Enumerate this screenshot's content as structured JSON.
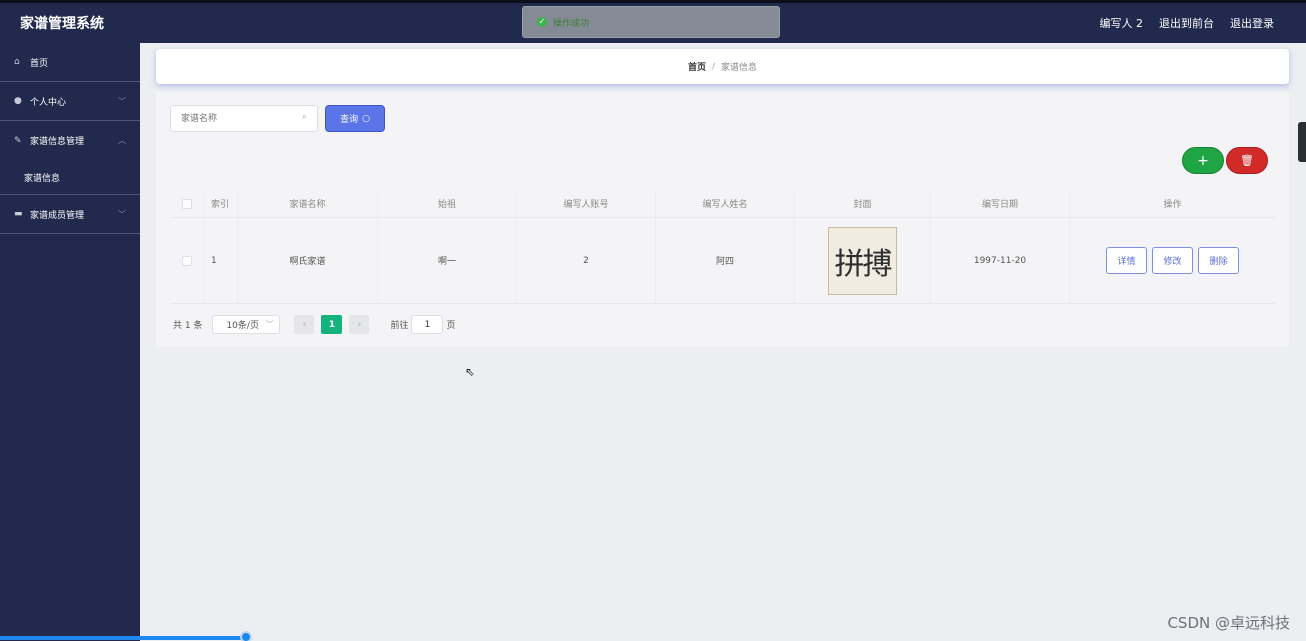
{
  "header": {
    "brand": "家谱管理系统",
    "user": "编写人 2",
    "exit_front": "退出到前台",
    "logout": "退出登录"
  },
  "toast": {
    "text": "操作成功",
    "icon": "check-circle-icon"
  },
  "sidebar": {
    "items": [
      {
        "label": "首页",
        "icon": "home-icon"
      },
      {
        "label": "个人中心",
        "icon": "user-icon"
      },
      {
        "label": "家谱信息管理",
        "icon": "book-icon"
      },
      {
        "label": "家谱信息",
        "sub": true
      },
      {
        "label": "家谱成员管理",
        "icon": "monitor-icon"
      }
    ]
  },
  "breadcrumb": {
    "home": "首页",
    "separator": "/",
    "current": "家谱信息"
  },
  "search": {
    "placeholder": "家谱名称",
    "button": "查询"
  },
  "table": {
    "headers": [
      "索引",
      "家谱名称",
      "始祖",
      "编写人账号",
      "编写人姓名",
      "封面",
      "编写日期",
      "操作"
    ],
    "rows": [
      {
        "index": "1",
        "name": "啊氏家谱",
        "ancestor": "啊一",
        "account": "2",
        "writer": "阿四",
        "cover_text": "拼搏",
        "date": "1997-11-20"
      }
    ],
    "actions": {
      "detail": "详情",
      "edit": "修改",
      "delete": "删除"
    }
  },
  "pagination": {
    "total": "共 1 条",
    "page_size": "10条/页",
    "current_page": "1",
    "goto_label": "前往",
    "goto_value": "1",
    "page_suffix": "页"
  },
  "watermark": "CSDN @卓远科技",
  "colors": {
    "header_bg": "#212a4d",
    "primary": "#5b75e8",
    "add": "#1fa543",
    "delete": "#d22929",
    "page_active": "#15b37c"
  }
}
